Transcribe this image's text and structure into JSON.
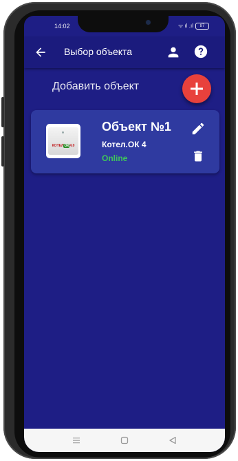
{
  "status_bar": {
    "time": "14:02",
    "signal": "ᯤ ıl .ıl",
    "battery": "87"
  },
  "app_bar": {
    "title": "Выбор объекта",
    "back_icon": "arrow-back-icon",
    "account_icon": "person-icon",
    "help_icon": "help-circle-icon"
  },
  "add_object": {
    "label": "Добавить объект",
    "button_icon": "plus-icon",
    "button_color": "#e8413c"
  },
  "objects": [
    {
      "name": "Объект №1",
      "device": "Котел.ОК 4",
      "status": "Online",
      "status_color": "#3fc55a",
      "thumb_logo": "КОТЕЛ",
      "thumb_logo_ok": "ОК",
      "thumb_logo_ver": "4.0"
    }
  ],
  "colors": {
    "background": "#1e1e85",
    "app_bar": "#1b1b7d",
    "card": "#2f3aa0"
  },
  "nav_bar": {
    "icons": [
      "menu-icon",
      "home-square-icon",
      "back-triangle-icon"
    ]
  }
}
